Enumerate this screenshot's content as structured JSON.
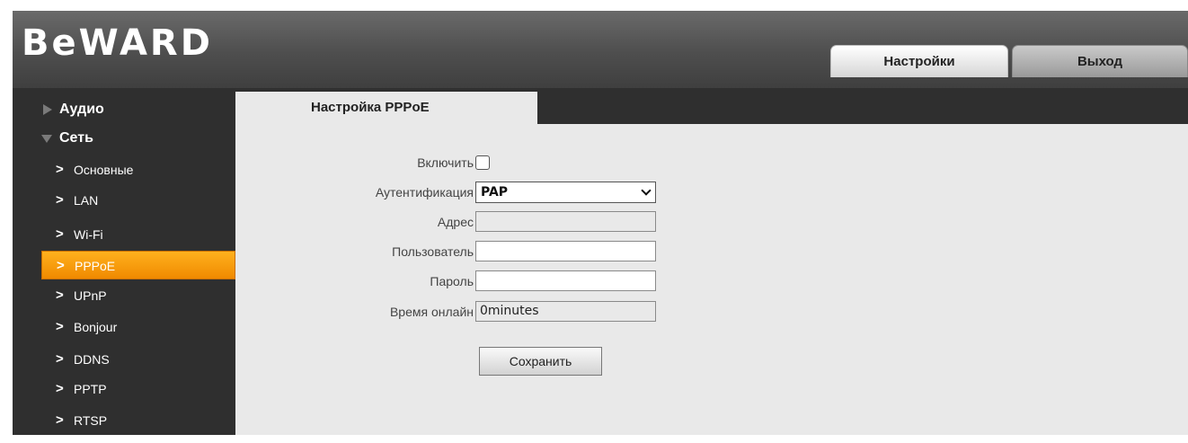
{
  "header": {
    "logo_text": "BeWARD",
    "tabs": [
      {
        "label": "Настройки"
      },
      {
        "label": "Выход"
      }
    ]
  },
  "sidebar": {
    "sections": [
      {
        "label": "Аудио",
        "icon": "triangle-right-icon"
      },
      {
        "label": "Сеть",
        "icon": "triangle-down-icon"
      }
    ],
    "items": [
      {
        "label": "Основные"
      },
      {
        "label": "LAN"
      },
      {
        "label": "Wi-Fi"
      },
      {
        "label": "PPPoE",
        "active": true
      },
      {
        "label": "UPnP"
      },
      {
        "label": "Bonjour"
      },
      {
        "label": "DDNS"
      },
      {
        "label": "PPTP"
      },
      {
        "label": "RTSP"
      }
    ],
    "chevron": ">"
  },
  "panel": {
    "title": "Настройка PPPoE",
    "fields": {
      "enable_label": "Включить",
      "enable_checked": false,
      "auth_label": "Аутентификация",
      "auth_value": "PAP",
      "address_label": "Адрес",
      "address_value": "",
      "user_label": "Пользователь",
      "user_value": "",
      "password_label": "Пароль",
      "password_value": "",
      "online_label": "Время онлайн",
      "online_value": "0minutes"
    },
    "save_label": "Сохранить"
  },
  "colors": {
    "accent_active": "#f5a00f",
    "frame_bg": "#2f2f2f",
    "panel_bg": "#e9e9e9"
  }
}
